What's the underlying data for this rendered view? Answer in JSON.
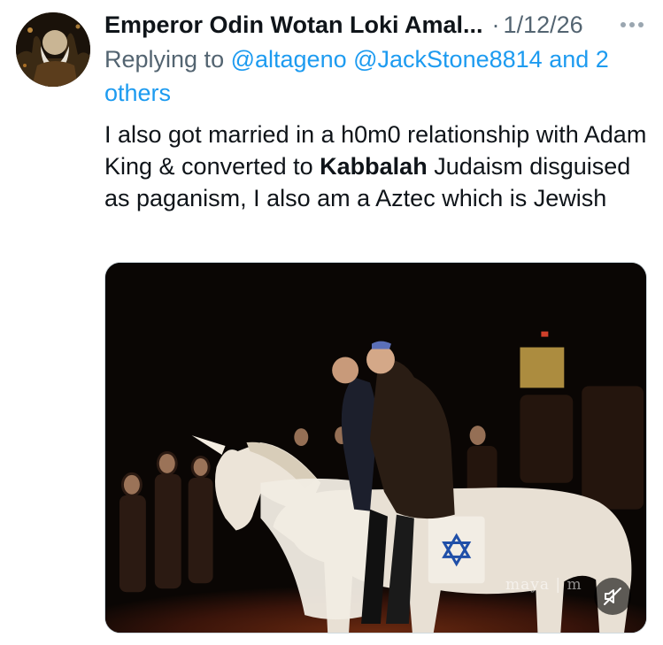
{
  "tweet": {
    "display_name": "Emperor Odin Wotan Loki Amal...",
    "separator": "·",
    "timestamp": "1/12/26",
    "reply": {
      "prefix": "Replying to ",
      "mention_1": "@altageno",
      "mention_2": "@JackStone8814",
      "others": "and 2 others"
    },
    "text": {
      "part_1": "I also got married in a h0m0 relationship with Adam King & converted to ",
      "bold": "Kabbalah",
      "part_2": " Judaism disguised as paganism, I also am a Aztec which is Jewish"
    },
    "media": {
      "watermark": "maya | m",
      "mute_icon": "muted-speaker-icon"
    },
    "icons": {
      "more": "more-horizontal-icon",
      "avatar": "avatar-image"
    },
    "colors": {
      "text": "#0f1419",
      "secondary": "#536471",
      "link": "#1d9bf0"
    }
  }
}
